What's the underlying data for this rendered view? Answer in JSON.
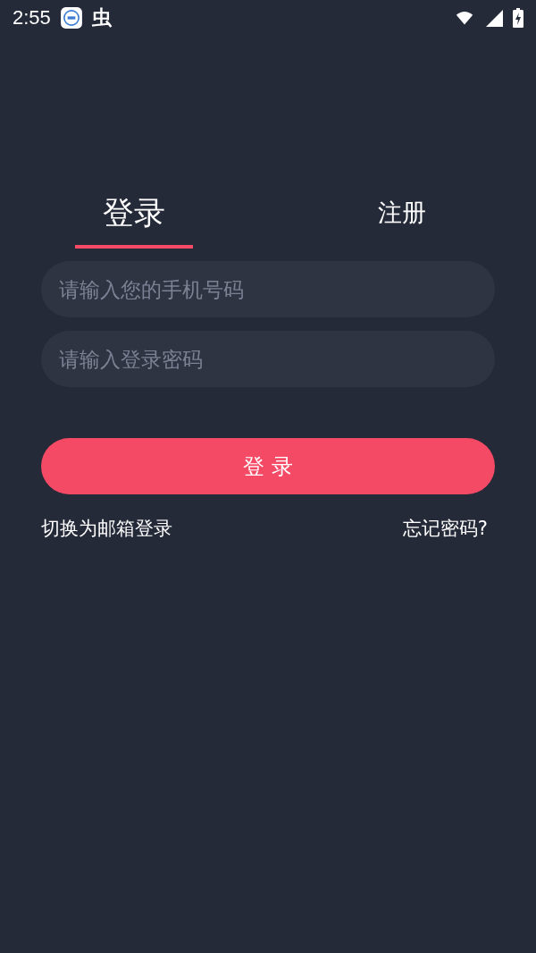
{
  "status_bar": {
    "time": "2:55",
    "app_glyph": "虫"
  },
  "tabs": [
    {
      "label": "登录",
      "selected": true
    },
    {
      "label": "注册",
      "selected": false
    }
  ],
  "fields": [
    {
      "placeholder": "请输入您的手机号码"
    },
    {
      "placeholder": "请输入登录密码"
    }
  ],
  "submit": {
    "label": "登 录"
  },
  "links": {
    "switch": "切换为邮箱登录",
    "forgot": "忘记密码?"
  }
}
